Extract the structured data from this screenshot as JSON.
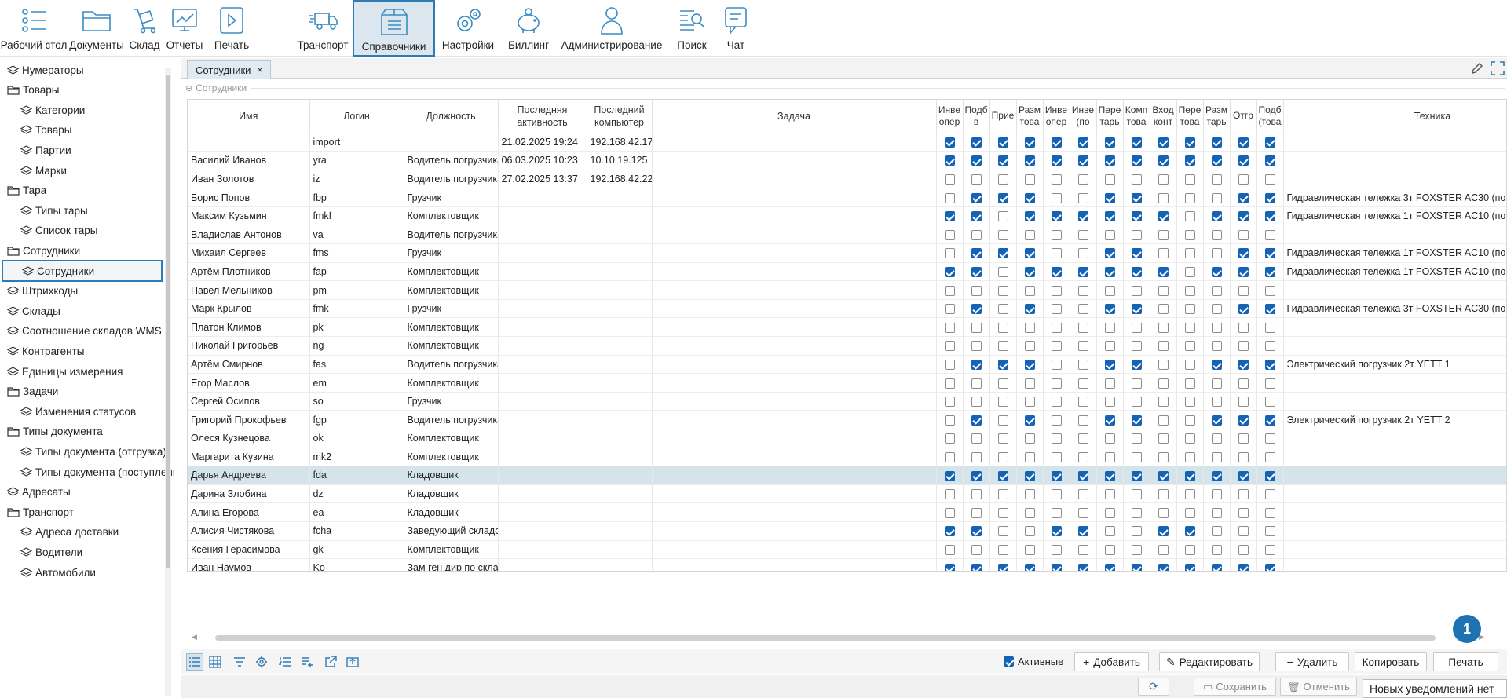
{
  "toolbar": {
    "items": [
      {
        "label": "Рабочий стол",
        "icon": "desktop-icon"
      },
      {
        "label": "Документы",
        "icon": "folder-icon"
      },
      {
        "label": "Склад",
        "icon": "cart-icon"
      },
      {
        "label": "Отчеты",
        "icon": "report-icon"
      },
      {
        "label": "Печать",
        "icon": "print-icon"
      },
      {
        "label": "Транспорт",
        "icon": "truck-icon"
      },
      {
        "label": "Справочники",
        "icon": "box-icon"
      },
      {
        "label": "Настройки",
        "icon": "gear-icon"
      },
      {
        "label": "Биллинг",
        "icon": "piggy-bank-icon"
      },
      {
        "label": "Администрирование",
        "icon": "user-icon"
      },
      {
        "label": "Поиск",
        "icon": "search-icon"
      },
      {
        "label": "Чат",
        "icon": "chat-icon"
      }
    ],
    "selected": "Справочники"
  },
  "sidebar": {
    "items": [
      {
        "label": "Нумераторы",
        "level": 0,
        "icon": "layers-icon"
      },
      {
        "label": "Товары",
        "level": 0,
        "icon": "folder-icon"
      },
      {
        "label": "Категории",
        "level": 1,
        "icon": "layers-icon"
      },
      {
        "label": "Товары",
        "level": 1,
        "icon": "layers-icon"
      },
      {
        "label": "Партии",
        "level": 1,
        "icon": "layers-icon"
      },
      {
        "label": "Марки",
        "level": 1,
        "icon": "layers-icon"
      },
      {
        "label": "Тара",
        "level": 0,
        "icon": "folder-icon"
      },
      {
        "label": "Типы тары",
        "level": 1,
        "icon": "layers-icon"
      },
      {
        "label": "Список тары",
        "level": 1,
        "icon": "layers-icon"
      },
      {
        "label": "Сотрудники",
        "level": 0,
        "icon": "folder-icon"
      },
      {
        "label": "Сотрудники",
        "level": 1,
        "icon": "layers-icon",
        "selected": true
      },
      {
        "label": "Штрихкоды",
        "level": 0,
        "icon": "layers-icon"
      },
      {
        "label": "Склады",
        "level": 0,
        "icon": "layers-icon"
      },
      {
        "label": "Соотношение складов WMS",
        "level": 0,
        "icon": "layers-icon"
      },
      {
        "label": "Контрагенты",
        "level": 0,
        "icon": "layers-icon"
      },
      {
        "label": "Единицы измерения",
        "level": 0,
        "icon": "layers-icon"
      },
      {
        "label": "Задачи",
        "level": 0,
        "icon": "folder-icon"
      },
      {
        "label": "Изменения статусов",
        "level": 1,
        "icon": "layers-icon"
      },
      {
        "label": "Типы документа",
        "level": 0,
        "icon": "folder-icon"
      },
      {
        "label": "Типы документа (отгрузка)",
        "level": 1,
        "icon": "layers-icon"
      },
      {
        "label": "Типы документа (поступление)",
        "level": 1,
        "icon": "layers-icon"
      },
      {
        "label": "Адресаты",
        "level": 0,
        "icon": "layers-icon"
      },
      {
        "label": "Транспорт",
        "level": 0,
        "icon": "folder-icon"
      },
      {
        "label": "Адреса доставки",
        "level": 1,
        "icon": "layers-icon"
      },
      {
        "label": "Водители",
        "level": 1,
        "icon": "layers-icon"
      },
      {
        "label": "Автомобили",
        "level": 1,
        "icon": "layers-icon"
      }
    ]
  },
  "tab": {
    "label": "Сотрудники",
    "close": "×"
  },
  "group_title": "Сотрудники",
  "grid": {
    "columns": [
      {
        "label": "Имя",
        "w": 155
      },
      {
        "label": "Логин",
        "w": 120
      },
      {
        "label": "Должность",
        "w": 120
      },
      {
        "label": "Последняя активность",
        "w": 113
      },
      {
        "label": "Последний компьютер",
        "w": 83
      },
      {
        "label": "Задача",
        "w": 362
      },
      {
        "label": "Инве опер",
        "w": 34
      },
      {
        "label": "Подб в",
        "w": 34
      },
      {
        "label": "Прие",
        "w": 34
      },
      {
        "label": "Разм това",
        "w": 34
      },
      {
        "label": "Инве опер",
        "w": 34
      },
      {
        "label": "Инве (по",
        "w": 34
      },
      {
        "label": "Пере тарь",
        "w": 34
      },
      {
        "label": "Комп това",
        "w": 34
      },
      {
        "label": "Вход конт",
        "w": 34
      },
      {
        "label": "Пере това",
        "w": 34
      },
      {
        "label": "Разм тарь",
        "w": 34
      },
      {
        "label": "Отгр",
        "w": 34
      },
      {
        "label": "Подб (това",
        "w": 34
      },
      {
        "label": "Техника",
        "w": 380
      }
    ],
    "rows": [
      {
        "name": "",
        "login": "import",
        "position": "",
        "activity": "21.02.2025 19:24",
        "computer": "192.168.42.17",
        "task": "",
        "checks": [
          1,
          1,
          1,
          1,
          1,
          1,
          1,
          1,
          1,
          1,
          1,
          1,
          1
        ],
        "equipment": ""
      },
      {
        "name": "Василий Иванов",
        "login": "yra",
        "position": "Водитель погрузчика",
        "activity": "06.03.2025 10:23",
        "computer": "10.10.19.125",
        "task": "",
        "checks": [
          1,
          1,
          1,
          1,
          1,
          1,
          1,
          1,
          1,
          1,
          1,
          1,
          1
        ],
        "equipment": ""
      },
      {
        "name": "Иван Золотов",
        "login": "iz",
        "position": "Водитель погрузчика",
        "activity": "27.02.2025 13:37",
        "computer": "192.168.42.22",
        "task": "",
        "checks": [
          0,
          0,
          0,
          0,
          0,
          0,
          0,
          0,
          0,
          0,
          0,
          0,
          0
        ],
        "equipment": ""
      },
      {
        "name": "Борис Попов",
        "login": "fbp",
        "position": "Грузчик",
        "activity": "",
        "computer": "",
        "task": "",
        "checks": [
          0,
          1,
          1,
          1,
          0,
          0,
          1,
          1,
          0,
          0,
          0,
          1,
          1
        ],
        "equipment": "Гидравлическая тележка 3т FOXSTER AC30 (по"
      },
      {
        "name": "Максим Кузьмин",
        "login": "fmkf",
        "position": "Комплектовщик",
        "activity": "",
        "computer": "",
        "task": "",
        "checks": [
          1,
          1,
          0,
          1,
          1,
          1,
          1,
          1,
          1,
          0,
          1,
          1,
          1
        ],
        "equipment": "Гидравлическая тележка 1т FOXSTER AC10 (по"
      },
      {
        "name": "Владислав Антонов",
        "login": "va",
        "position": "Водитель погрузчика",
        "activity": "",
        "computer": "",
        "task": "",
        "checks": [
          0,
          0,
          0,
          0,
          0,
          0,
          0,
          0,
          0,
          0,
          0,
          0,
          0
        ],
        "equipment": ""
      },
      {
        "name": "Михаил Сергеев",
        "login": "fms",
        "position": "Грузчик",
        "activity": "",
        "computer": "",
        "task": "",
        "checks": [
          0,
          1,
          1,
          1,
          0,
          0,
          1,
          1,
          0,
          0,
          0,
          1,
          1
        ],
        "equipment": "Гидравлическая тележка 1т FOXSTER AC10 (по"
      },
      {
        "name": "Артём Плотников",
        "login": "fap",
        "position": "Комплектовщик",
        "activity": "",
        "computer": "",
        "task": "",
        "checks": [
          1,
          1,
          0,
          1,
          1,
          1,
          1,
          1,
          1,
          0,
          1,
          1,
          1
        ],
        "equipment": "Гидравлическая тележка 1т FOXSTER AC10 (по"
      },
      {
        "name": "Павел Мельников",
        "login": "pm",
        "position": "Комплектовщик",
        "activity": "",
        "computer": "",
        "task": "",
        "checks": [
          0,
          0,
          0,
          0,
          0,
          0,
          0,
          0,
          0,
          0,
          0,
          0,
          0
        ],
        "equipment": ""
      },
      {
        "name": "Марк Крылов",
        "login": "fmk",
        "position": "Грузчик",
        "activity": "",
        "computer": "",
        "task": "",
        "checks": [
          0,
          1,
          0,
          1,
          0,
          0,
          1,
          1,
          0,
          0,
          0,
          1,
          1
        ],
        "equipment": "Гидравлическая тележка 3т FOXSTER AC30 (по"
      },
      {
        "name": "Платон Климов",
        "login": "pk",
        "position": "Комплектовщик",
        "activity": "",
        "computer": "",
        "task": "",
        "checks": [
          0,
          0,
          0,
          0,
          0,
          0,
          0,
          0,
          0,
          0,
          0,
          0,
          0
        ],
        "equipment": ""
      },
      {
        "name": "Николай Григорьев",
        "login": "ng",
        "position": "Комплектовщик",
        "activity": "",
        "computer": "",
        "task": "",
        "checks": [
          0,
          0,
          0,
          0,
          0,
          0,
          0,
          0,
          0,
          0,
          0,
          0,
          0
        ],
        "equipment": ""
      },
      {
        "name": "Артём Смирнов",
        "login": "fas",
        "position": "Водитель погрузчика",
        "activity": "",
        "computer": "",
        "task": "",
        "checks": [
          0,
          1,
          1,
          1,
          0,
          0,
          1,
          1,
          0,
          0,
          1,
          1,
          1
        ],
        "equipment": "Электрический погрузчик 2т YETT 1"
      },
      {
        "name": "Егор Маслов",
        "login": "em",
        "position": "Комплектовщик",
        "activity": "",
        "computer": "",
        "task": "",
        "checks": [
          0,
          0,
          0,
          0,
          0,
          0,
          0,
          0,
          0,
          0,
          0,
          0,
          0
        ],
        "equipment": ""
      },
      {
        "name": "Сергей Осипов",
        "login": "so",
        "position": "Грузчик",
        "activity": "",
        "computer": "",
        "task": "",
        "checks": [
          0,
          0,
          0,
          0,
          0,
          0,
          0,
          0,
          0,
          0,
          0,
          0,
          0
        ],
        "equipment": ""
      },
      {
        "name": "Григорий Прокофьев",
        "login": "fgp",
        "position": "Водитель погрузчика",
        "activity": "",
        "computer": "",
        "task": "",
        "checks": [
          0,
          1,
          0,
          1,
          0,
          0,
          1,
          1,
          0,
          0,
          1,
          1,
          1
        ],
        "equipment": "Электрический погрузчик 2т YETT 2"
      },
      {
        "name": "Олеся Кузнецова",
        "login": "ok",
        "position": "Комплектовщик",
        "activity": "",
        "computer": "",
        "task": "",
        "checks": [
          0,
          0,
          0,
          0,
          0,
          0,
          0,
          0,
          0,
          0,
          0,
          0,
          0
        ],
        "equipment": ""
      },
      {
        "name": "Маргарита Кузина",
        "login": "mk2",
        "position": "Комплектовщик",
        "activity": "",
        "computer": "",
        "task": "",
        "checks": [
          0,
          0,
          0,
          0,
          0,
          0,
          0,
          0,
          0,
          0,
          0,
          0,
          0
        ],
        "equipment": ""
      },
      {
        "name": "Дарья Андреева",
        "login": "fda",
        "position": "Кладовщик",
        "activity": "",
        "computer": "",
        "task": "",
        "checks": [
          1,
          1,
          1,
          1,
          1,
          1,
          1,
          1,
          1,
          1,
          1,
          1,
          1
        ],
        "equipment": "",
        "selected": true
      },
      {
        "name": "Дарина Злобина",
        "login": "dz",
        "position": "Кладовщик",
        "activity": "",
        "computer": "",
        "task": "",
        "checks": [
          0,
          0,
          0,
          0,
          0,
          0,
          0,
          0,
          0,
          0,
          0,
          0,
          0
        ],
        "equipment": ""
      },
      {
        "name": "Алина Егорова",
        "login": "ea",
        "position": "Кладовщик",
        "activity": "",
        "computer": "",
        "task": "",
        "checks": [
          0,
          0,
          0,
          0,
          0,
          0,
          0,
          0,
          0,
          0,
          0,
          0,
          0
        ],
        "equipment": ""
      },
      {
        "name": "Алисия Чистякова",
        "login": "fcha",
        "position": "Заведующий складом",
        "activity": "",
        "computer": "",
        "task": "",
        "checks": [
          1,
          1,
          0,
          0,
          1,
          1,
          0,
          0,
          1,
          1,
          0,
          0,
          0
        ],
        "equipment": ""
      },
      {
        "name": "Ксения Герасимова",
        "login": "gk",
        "position": "Комплектовщик",
        "activity": "",
        "computer": "",
        "task": "",
        "checks": [
          0,
          0,
          0,
          0,
          0,
          0,
          0,
          0,
          0,
          0,
          0,
          0,
          0
        ],
        "equipment": ""
      },
      {
        "name": "Иван Наумов",
        "login": "Ko",
        "position": "Зам ген дир по складу",
        "activity": "",
        "computer": "",
        "task": "",
        "checks": [
          1,
          1,
          1,
          1,
          1,
          1,
          1,
          1,
          1,
          1,
          1,
          1,
          1
        ],
        "equipment": ""
      }
    ]
  },
  "bottom": {
    "active_label": "Активные",
    "active_checked": true,
    "add": "Добавить",
    "edit": "Редактировать",
    "delete": "Удалить",
    "copy": "Копировать",
    "print": "Печать"
  },
  "footer": {
    "save": "Сохранить",
    "cancel": "Отменить",
    "notification": "Новых уведомлений нет"
  },
  "badge": "1",
  "colors": {
    "accent": "#2e7bb6",
    "check": "#1463b5",
    "selected_row": "#d5e4ea",
    "icon": "#3a8cc4"
  }
}
